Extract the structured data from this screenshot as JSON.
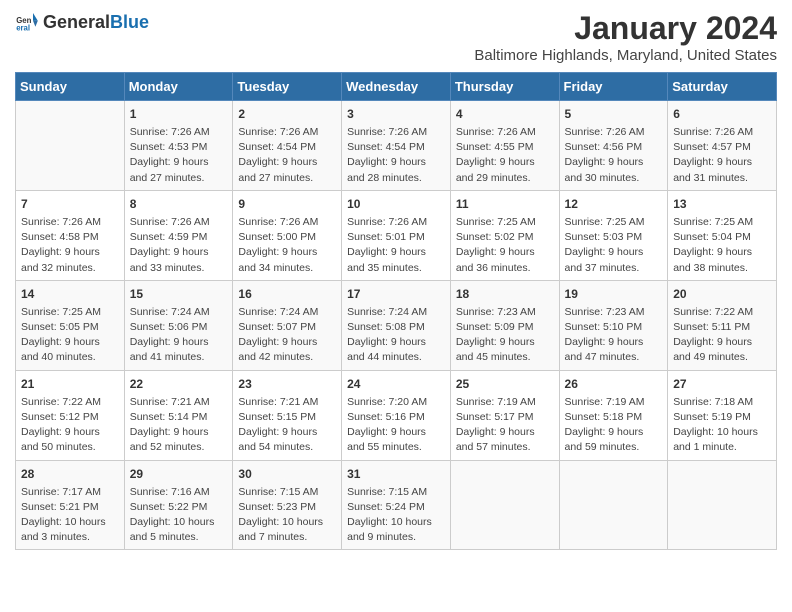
{
  "header": {
    "logo_general": "General",
    "logo_blue": "Blue",
    "title": "January 2024",
    "subtitle": "Baltimore Highlands, Maryland, United States"
  },
  "days": [
    "Sunday",
    "Monday",
    "Tuesday",
    "Wednesday",
    "Thursday",
    "Friday",
    "Saturday"
  ],
  "weeks": [
    [
      {
        "date": "",
        "content": ""
      },
      {
        "date": "1",
        "content": "Sunrise: 7:26 AM\nSunset: 4:53 PM\nDaylight: 9 hours\nand 27 minutes."
      },
      {
        "date": "2",
        "content": "Sunrise: 7:26 AM\nSunset: 4:54 PM\nDaylight: 9 hours\nand 27 minutes."
      },
      {
        "date": "3",
        "content": "Sunrise: 7:26 AM\nSunset: 4:54 PM\nDaylight: 9 hours\nand 28 minutes."
      },
      {
        "date": "4",
        "content": "Sunrise: 7:26 AM\nSunset: 4:55 PM\nDaylight: 9 hours\nand 29 minutes."
      },
      {
        "date": "5",
        "content": "Sunrise: 7:26 AM\nSunset: 4:56 PM\nDaylight: 9 hours\nand 30 minutes."
      },
      {
        "date": "6",
        "content": "Sunrise: 7:26 AM\nSunset: 4:57 PM\nDaylight: 9 hours\nand 31 minutes."
      }
    ],
    [
      {
        "date": "7",
        "content": "Sunrise: 7:26 AM\nSunset: 4:58 PM\nDaylight: 9 hours\nand 32 minutes."
      },
      {
        "date": "8",
        "content": "Sunrise: 7:26 AM\nSunset: 4:59 PM\nDaylight: 9 hours\nand 33 minutes."
      },
      {
        "date": "9",
        "content": "Sunrise: 7:26 AM\nSunset: 5:00 PM\nDaylight: 9 hours\nand 34 minutes."
      },
      {
        "date": "10",
        "content": "Sunrise: 7:26 AM\nSunset: 5:01 PM\nDaylight: 9 hours\nand 35 minutes."
      },
      {
        "date": "11",
        "content": "Sunrise: 7:25 AM\nSunset: 5:02 PM\nDaylight: 9 hours\nand 36 minutes."
      },
      {
        "date": "12",
        "content": "Sunrise: 7:25 AM\nSunset: 5:03 PM\nDaylight: 9 hours\nand 37 minutes."
      },
      {
        "date": "13",
        "content": "Sunrise: 7:25 AM\nSunset: 5:04 PM\nDaylight: 9 hours\nand 38 minutes."
      }
    ],
    [
      {
        "date": "14",
        "content": "Sunrise: 7:25 AM\nSunset: 5:05 PM\nDaylight: 9 hours\nand 40 minutes."
      },
      {
        "date": "15",
        "content": "Sunrise: 7:24 AM\nSunset: 5:06 PM\nDaylight: 9 hours\nand 41 minutes."
      },
      {
        "date": "16",
        "content": "Sunrise: 7:24 AM\nSunset: 5:07 PM\nDaylight: 9 hours\nand 42 minutes."
      },
      {
        "date": "17",
        "content": "Sunrise: 7:24 AM\nSunset: 5:08 PM\nDaylight: 9 hours\nand 44 minutes."
      },
      {
        "date": "18",
        "content": "Sunrise: 7:23 AM\nSunset: 5:09 PM\nDaylight: 9 hours\nand 45 minutes."
      },
      {
        "date": "19",
        "content": "Sunrise: 7:23 AM\nSunset: 5:10 PM\nDaylight: 9 hours\nand 47 minutes."
      },
      {
        "date": "20",
        "content": "Sunrise: 7:22 AM\nSunset: 5:11 PM\nDaylight: 9 hours\nand 49 minutes."
      }
    ],
    [
      {
        "date": "21",
        "content": "Sunrise: 7:22 AM\nSunset: 5:12 PM\nDaylight: 9 hours\nand 50 minutes."
      },
      {
        "date": "22",
        "content": "Sunrise: 7:21 AM\nSunset: 5:14 PM\nDaylight: 9 hours\nand 52 minutes."
      },
      {
        "date": "23",
        "content": "Sunrise: 7:21 AM\nSunset: 5:15 PM\nDaylight: 9 hours\nand 54 minutes."
      },
      {
        "date": "24",
        "content": "Sunrise: 7:20 AM\nSunset: 5:16 PM\nDaylight: 9 hours\nand 55 minutes."
      },
      {
        "date": "25",
        "content": "Sunrise: 7:19 AM\nSunset: 5:17 PM\nDaylight: 9 hours\nand 57 minutes."
      },
      {
        "date": "26",
        "content": "Sunrise: 7:19 AM\nSunset: 5:18 PM\nDaylight: 9 hours\nand 59 minutes."
      },
      {
        "date": "27",
        "content": "Sunrise: 7:18 AM\nSunset: 5:19 PM\nDaylight: 10 hours\nand 1 minute."
      }
    ],
    [
      {
        "date": "28",
        "content": "Sunrise: 7:17 AM\nSunset: 5:21 PM\nDaylight: 10 hours\nand 3 minutes."
      },
      {
        "date": "29",
        "content": "Sunrise: 7:16 AM\nSunset: 5:22 PM\nDaylight: 10 hours\nand 5 minutes."
      },
      {
        "date": "30",
        "content": "Sunrise: 7:15 AM\nSunset: 5:23 PM\nDaylight: 10 hours\nand 7 minutes."
      },
      {
        "date": "31",
        "content": "Sunrise: 7:15 AM\nSunset: 5:24 PM\nDaylight: 10 hours\nand 9 minutes."
      },
      {
        "date": "",
        "content": ""
      },
      {
        "date": "",
        "content": ""
      },
      {
        "date": "",
        "content": ""
      }
    ]
  ]
}
